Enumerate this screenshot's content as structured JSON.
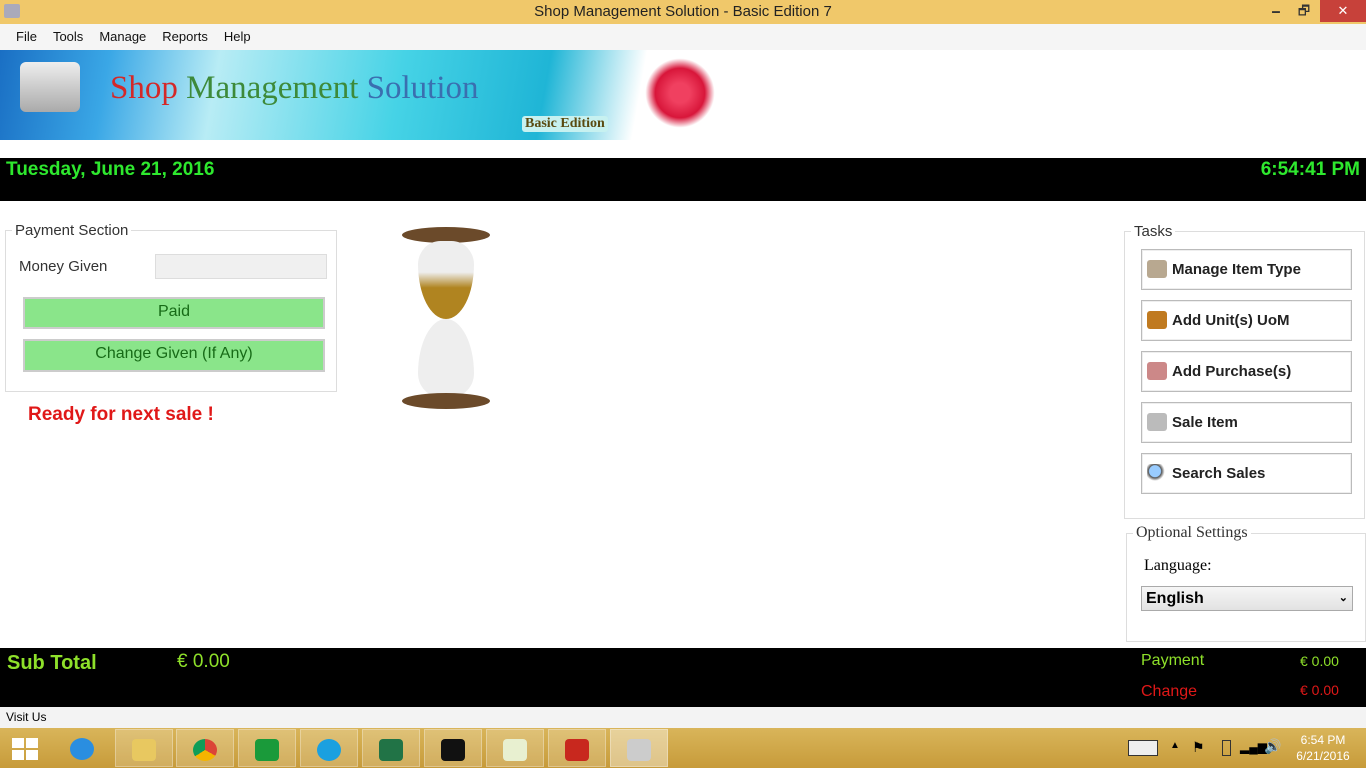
{
  "window": {
    "title": "Shop Management Solution - Basic Edition 7",
    "minimize": "🗕",
    "maximize": "🗗",
    "close": "✕"
  },
  "menu": [
    "File",
    "Tools",
    "Manage",
    "Reports",
    "Help"
  ],
  "banner": {
    "title_parts": [
      "Shop",
      "Management",
      "Solution"
    ],
    "edition": "Basic Edition"
  },
  "datebar": {
    "date": "Tuesday, June 21, 2016",
    "time": "6:54:41 PM"
  },
  "payment": {
    "legend": "Payment Section",
    "money_label": "Money Given",
    "money_value": "",
    "paid": "Paid",
    "change_given": "Change Given (If Any)",
    "status": "Ready for next sale !"
  },
  "tasks": {
    "legend": "Tasks",
    "items": [
      "Manage Item Type",
      "Add Unit(s) UoM",
      "Add Purchase(s)",
      "Sale Item",
      "Search Sales"
    ]
  },
  "settings": {
    "legend": "Optional Settings",
    "language_label": "Language:",
    "language": "English"
  },
  "totals": {
    "subtotal_label": "Sub Total",
    "subtotal": "€ 0.00",
    "payment_label": "Payment",
    "payment": "€ 0.00",
    "change_label": "Change",
    "change": "€ 0.00"
  },
  "visit": "Visit Us",
  "clock": {
    "time": "6:54 PM",
    "date": "6/21/2016"
  },
  "colors": {
    "green": "#2ee82e",
    "red": "#e01818",
    "lime": "#8ee02a"
  }
}
